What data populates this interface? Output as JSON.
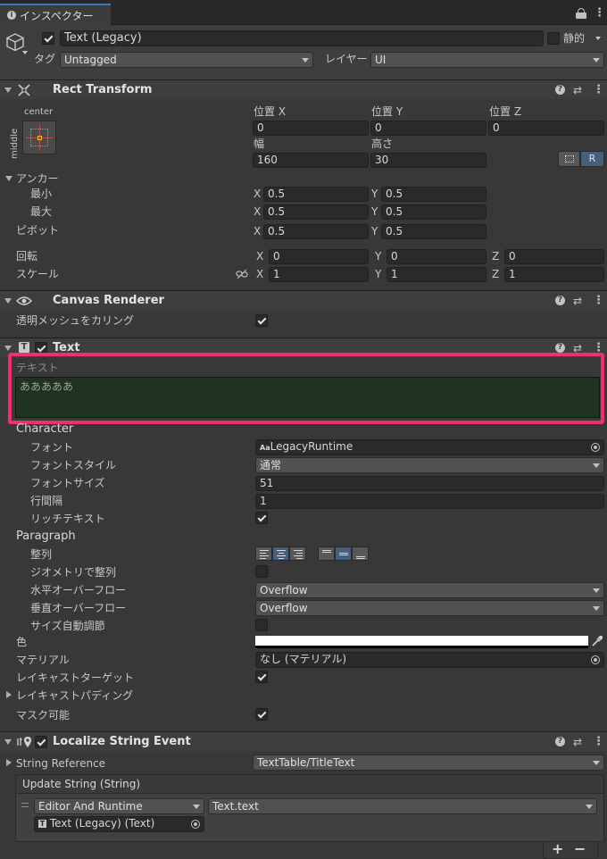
{
  "tab": {
    "title": "インスペクター"
  },
  "object": {
    "name": "Text (Legacy)",
    "static_label": "静的",
    "tag_label": "タグ",
    "tag_value": "Untagged",
    "layer_label": "レイヤー",
    "layer_value": "UI"
  },
  "rect_transform": {
    "title": "Rect Transform",
    "anchor_h": "center",
    "anchor_v": "middle",
    "pos_x_label": "位置 X",
    "pos_y_label": "位置 Y",
    "pos_z_label": "位置 Z",
    "pos_x": "0",
    "pos_y": "0",
    "pos_z": "0",
    "width_label": "幅",
    "height_label": "高さ",
    "width": "160",
    "height": "30",
    "r_button": "R",
    "anchors_label": "アンカー",
    "min_label": "最小",
    "max_label": "最大",
    "min_x": "0.5",
    "min_y": "0.5",
    "max_x": "0.5",
    "max_y": "0.5",
    "pivot_label": "ピボット",
    "pivot_x": "0.5",
    "pivot_y": "0.5",
    "rotation_label": "回転",
    "rot_x": "0",
    "rot_y": "0",
    "rot_z": "0",
    "scale_label": "スケール",
    "scale_x": "1",
    "scale_y": "1",
    "scale_z": "1",
    "axis_x": "X",
    "axis_y": "Y",
    "axis_z": "Z"
  },
  "canvas_renderer": {
    "title": "Canvas Renderer",
    "cull_label": "透明メッシュをカリング",
    "cull_checked": true
  },
  "text_component": {
    "title": "Text",
    "text_label": "テキスト",
    "text_value": "あああああ",
    "character_header": "Character",
    "font_label": "フォント",
    "font_value": "LegacyRuntime",
    "font_prefix": "Aa",
    "font_style_label": "フォントスタイル",
    "font_style_value": "通常",
    "font_size_label": "フォントサイズ",
    "font_size_value": "51",
    "line_spacing_label": "行間隔",
    "line_spacing_value": "1",
    "rich_text_label": "リッチテキスト",
    "rich_text_checked": true,
    "paragraph_header": "Paragraph",
    "alignment_label": "整列",
    "align_geometry_label": "ジオメトリで整列",
    "align_geometry_checked": false,
    "horizontal_overflow_label": "水平オーバーフロー",
    "horizontal_overflow_value": "Overflow",
    "vertical_overflow_label": "垂直オーバーフロー",
    "vertical_overflow_value": "Overflow",
    "best_fit_label": "サイズ自動調節",
    "best_fit_checked": false,
    "color_label": "色",
    "color_value": "#ffffff",
    "material_label": "マテリアル",
    "material_value": "なし (マテリアル)",
    "raycast_target_label": "レイキャストターゲット",
    "raycast_target_checked": true,
    "raycast_padding_label": "レイキャストパディング",
    "maskable_label": "マスク可能",
    "maskable_checked": true
  },
  "localize": {
    "title": "Localize String Event",
    "string_reference_label": "String Reference",
    "string_reference_value": "TextTable/TitleText",
    "update_string_label": "Update String (String)",
    "runtime_value": "Editor And Runtime",
    "function_value": "Text.text",
    "target_value": "Text (Legacy) (Text)",
    "add_button": "+",
    "remove_button": "−"
  },
  "colors": {
    "highlight_border": "#f0306a",
    "text_area_bg": "#1f3320",
    "selected_blue": "#46607c"
  },
  "icons": [
    "info-icon",
    "lock-icon",
    "menu-icon",
    "cube-icon",
    "rect-transform-icon",
    "eye-icon",
    "text-icon",
    "localize-icon",
    "help-icon",
    "preset-icon",
    "kebab-icon",
    "link-icon",
    "eyedropper-icon",
    "object-picker-icon"
  ]
}
